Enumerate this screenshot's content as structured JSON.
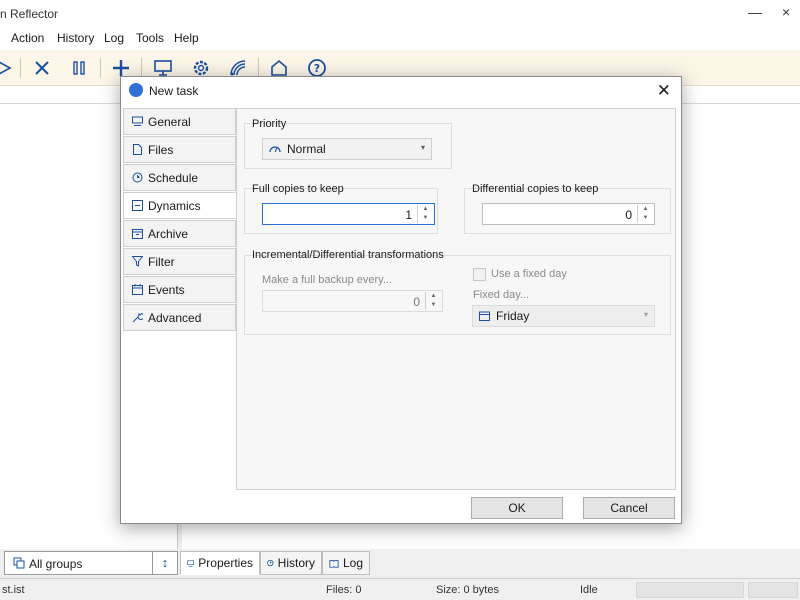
{
  "app": {
    "title": "n Reflector",
    "minimize": "—",
    "close": "×"
  },
  "menu": {
    "items": [
      "Action",
      "History",
      "Log",
      "Tools",
      "Help"
    ]
  },
  "toolbar": {
    "icons": [
      "play-icon",
      "cancel-icon",
      "pause-icon",
      "add-task-icon",
      "computer-icon",
      "settings-gear-icon",
      "wireless-icon",
      "home-icon",
      "help-icon"
    ]
  },
  "left_pane": {
    "groups_label": "All groups",
    "sort_glyph": "↕"
  },
  "bottom_tabs": {
    "properties": "Properties",
    "history": "History",
    "log": "Log"
  },
  "status": {
    "list": "st.ist",
    "files": "Files: 0",
    "size": "Size: 0 bytes",
    "state": "Idle"
  },
  "dialog": {
    "title": "New task",
    "close_glyph": "✕",
    "nav": [
      "General",
      "Files",
      "Schedule",
      "Dynamics",
      "Archive",
      "Filter",
      "Events",
      "Advanced"
    ],
    "active_nav": "Dynamics",
    "priority": {
      "label": "Priority",
      "value": "Normal"
    },
    "full_copies": {
      "label": "Full copies to keep",
      "value": "1"
    },
    "diff_copies": {
      "label": "Differential copies to keep",
      "value": "0"
    },
    "transform": {
      "label": "Incremental/Differential transformations",
      "make_full_label": "Make a full backup every...",
      "make_full_value": "0",
      "fixed_day_check": "Use a fixed day",
      "fixed_day_label": "Fixed day...",
      "fixed_day_value": "Friday"
    },
    "ok": "OK",
    "cancel": "Cancel"
  },
  "colors": {
    "accent": "#2a6fd6",
    "icon": "#1c4fa0",
    "toolbar_bg": "#fbf6e8"
  }
}
